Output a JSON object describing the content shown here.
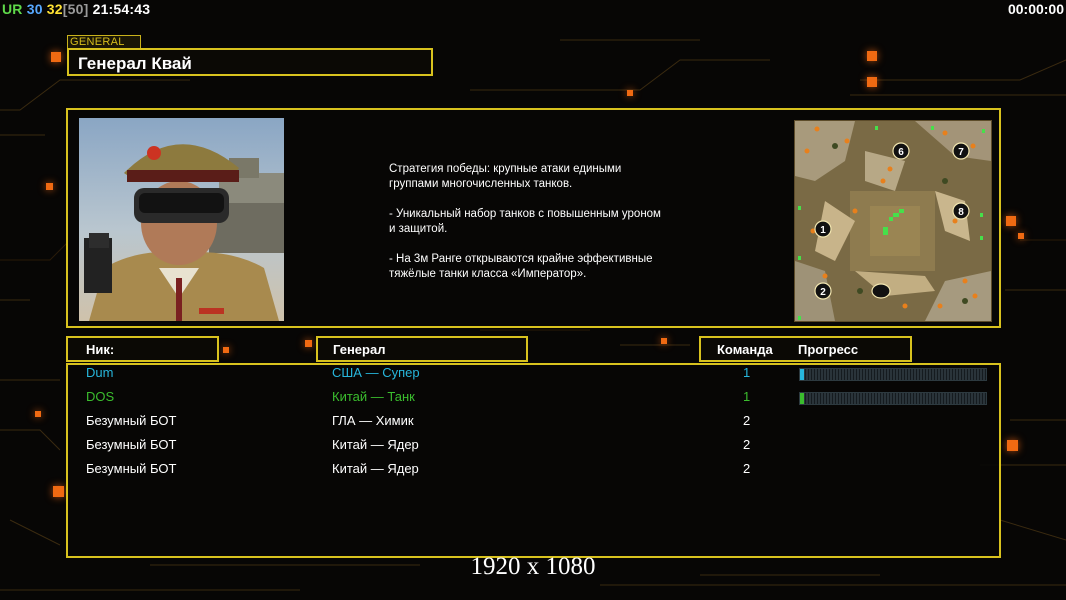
{
  "hud": {
    "tag": "UR",
    "v1": "30",
    "v2": "32",
    "v3": "[50]",
    "clock": "21:54:43",
    "timer": "00:00:00"
  },
  "general": {
    "tag": "GENERAL",
    "name": "Генерал Квай",
    "description": "Стратегия победы: крупные атаки едиными\n группами многочисленных танков.\n\n- Уникальный набор танков с повышенным уроном\n и защитой.\n\n- На 3м Ранге открываются крайне эффективные\n тяжёлые танки класса «Император»."
  },
  "minimap": {
    "positions": [
      "1",
      "2",
      "6",
      "7",
      "8"
    ]
  },
  "table": {
    "headers": {
      "nick": "Ник:",
      "general": "Генерал",
      "team": "Команда",
      "progress": "Прогресс"
    },
    "rows": [
      {
        "nick": "Dum",
        "general": "США — Супер",
        "team": "1",
        "color": "#27b6dc",
        "progress": 0.01
      },
      {
        "nick": "DOS",
        "general": "Китай — Танк",
        "team": "1",
        "color": "#3bbd2e",
        "progress": 0.01
      },
      {
        "nick": "Безумный БОТ",
        "general": "ГЛА — Химик",
        "team": "2",
        "color": "#ffffff"
      },
      {
        "nick": "Безумный БОТ",
        "general": "Китай — Ядер",
        "team": "2",
        "color": "#ffffff"
      },
      {
        "nick": "Безумный БОТ",
        "general": "Китай — Ядер",
        "team": "2",
        "color": "#ffffff"
      }
    ]
  },
  "overlay": {
    "resolution": "1920 x 1080"
  },
  "colors": {
    "frame": "#d8c21e",
    "accent_orange": "#f06a12"
  }
}
